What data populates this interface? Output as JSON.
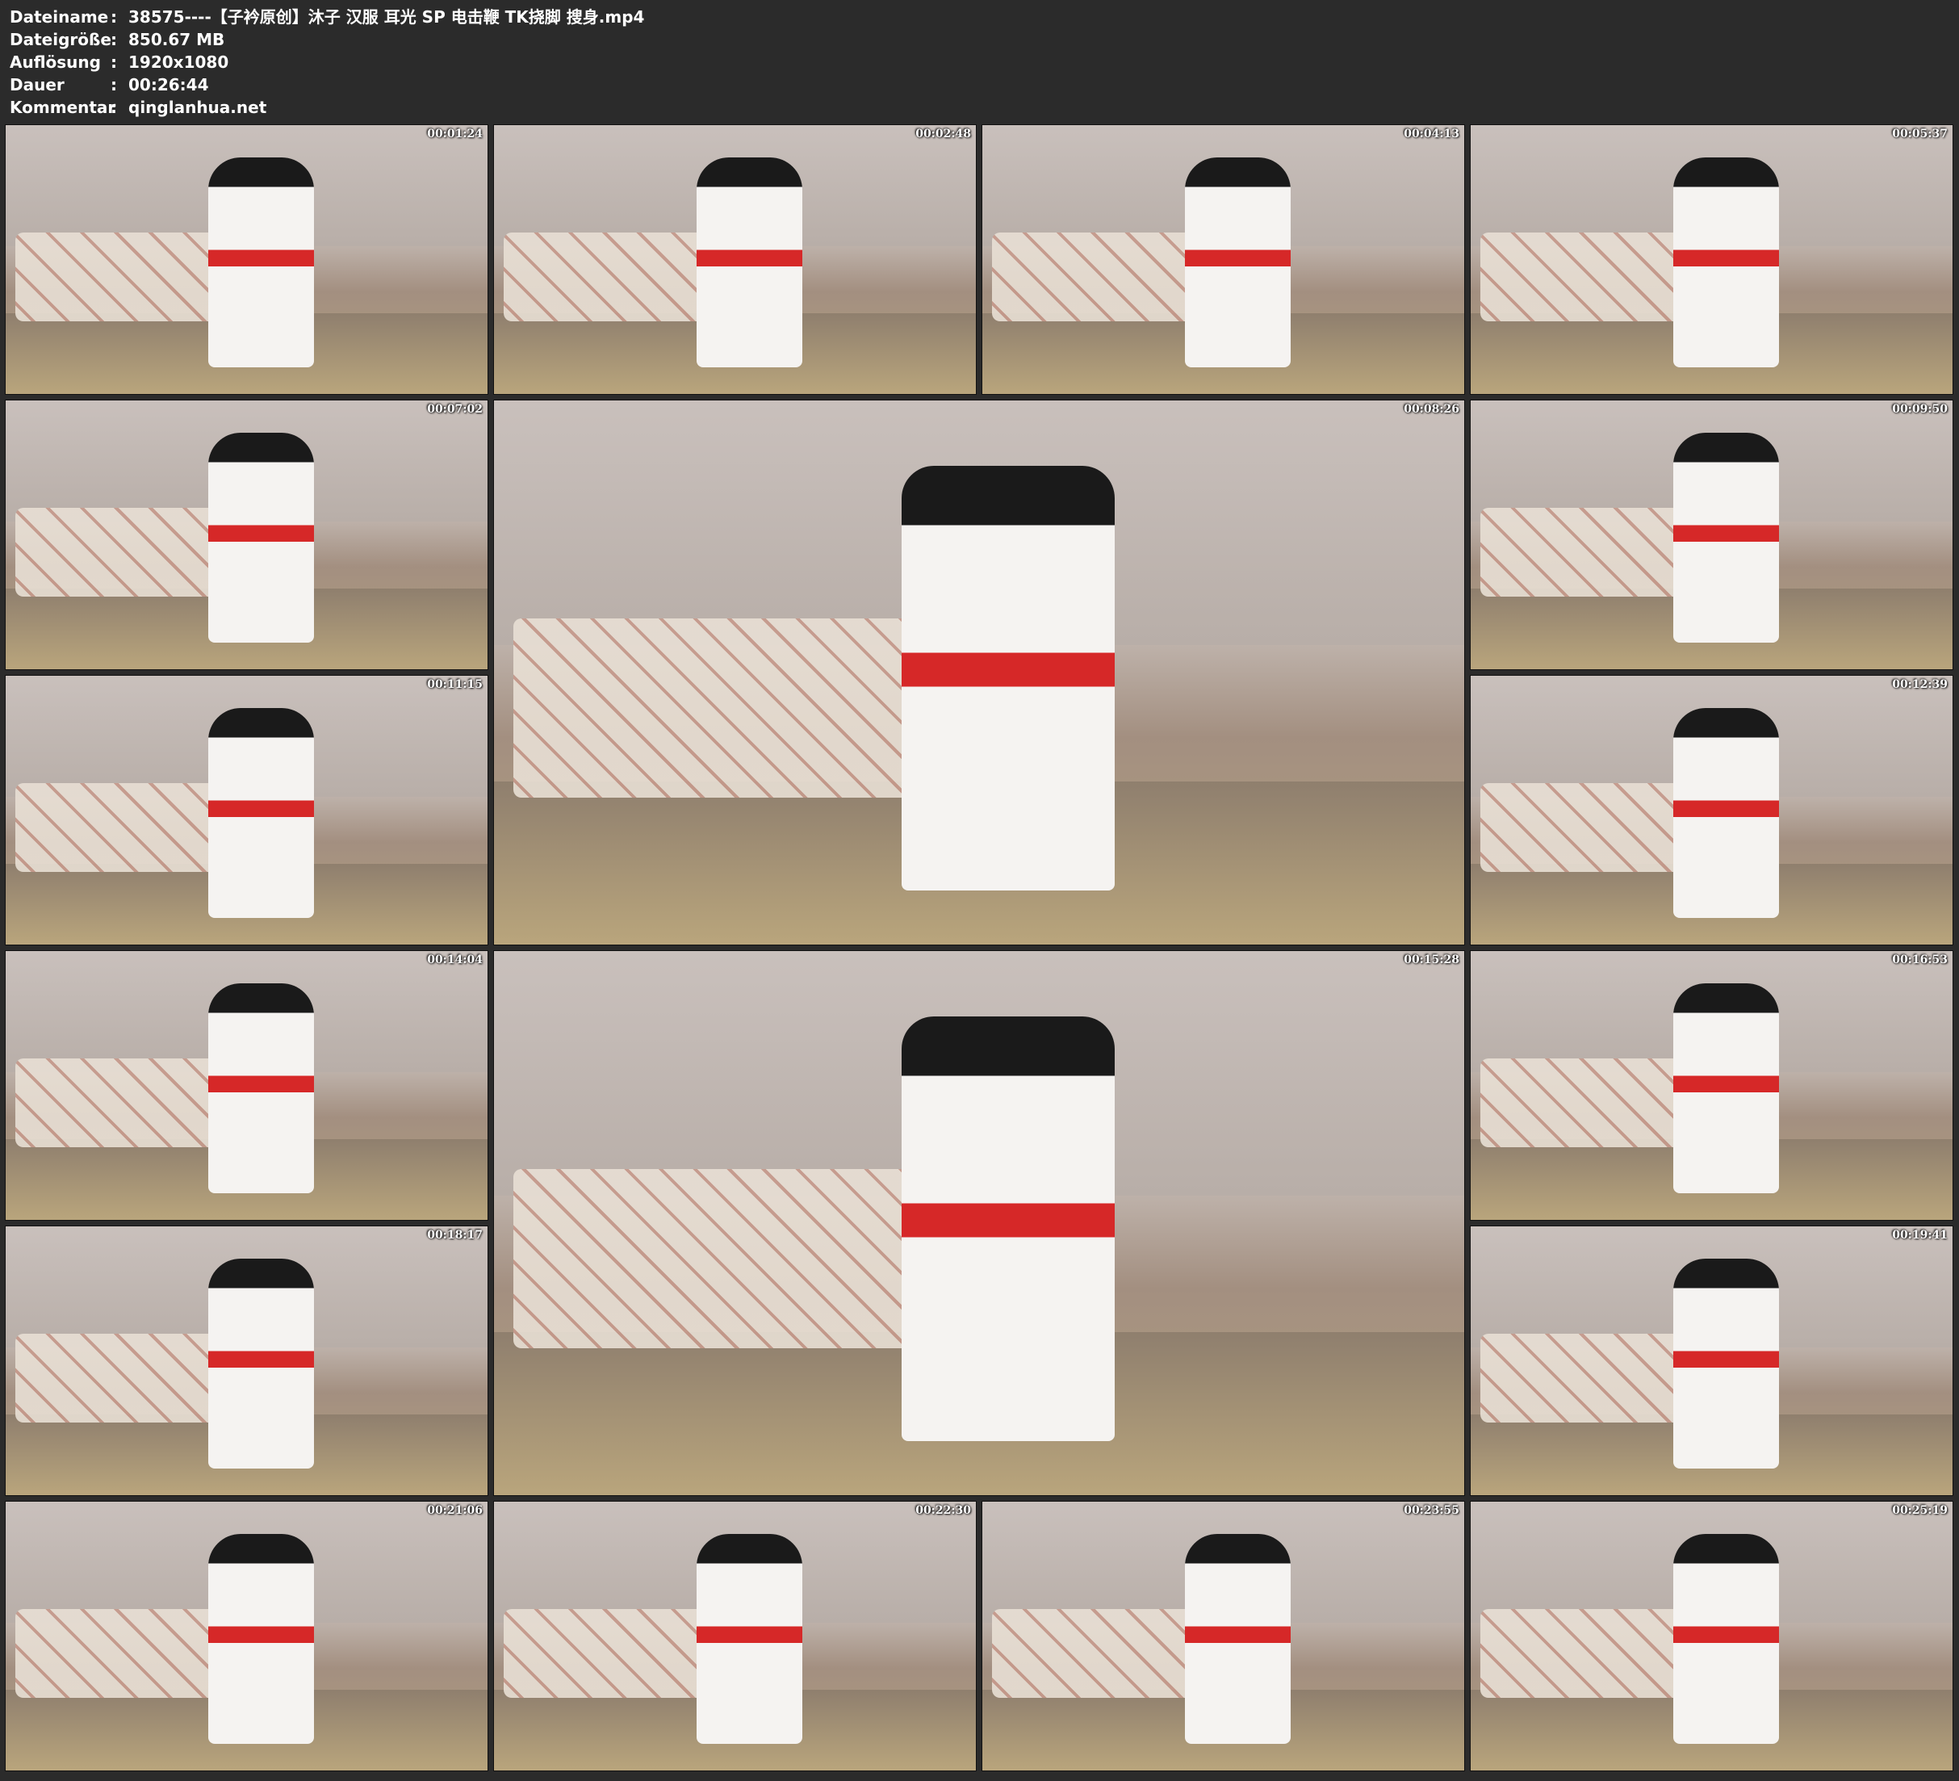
{
  "info": {
    "rows": [
      {
        "label": "Dateiname",
        "sep": ":",
        "value": "38575----【子衿原创】沐子 汉服 耳光 SP 电击鞭 TK挠脚 搜身.mp4"
      },
      {
        "label": "Dateigröße",
        "sep": ":",
        "value": "850.67 MB"
      },
      {
        "label": "Auflösung",
        "sep": ":",
        "value": "1920x1080"
      },
      {
        "label": "Dauer",
        "sep": ":",
        "value": "00:26:44"
      },
      {
        "label": "Kommentar",
        "sep": ":",
        "value": "qinglanhua.net"
      }
    ]
  },
  "thumbnails": [
    {
      "timestamp": "00:01:24"
    },
    {
      "timestamp": "00:02:48"
    },
    {
      "timestamp": "00:04:13"
    },
    {
      "timestamp": "00:05:37"
    },
    {
      "timestamp": "00:07:02"
    },
    {
      "timestamp": "00:08:26"
    },
    {
      "timestamp": "00:09:50"
    },
    {
      "timestamp": "00:11:15"
    },
    {
      "timestamp": "00:12:39"
    },
    {
      "timestamp": "00:14:04"
    },
    {
      "timestamp": "00:15:28"
    },
    {
      "timestamp": "00:16:53"
    },
    {
      "timestamp": "00:18:17"
    },
    {
      "timestamp": "00:19:41"
    },
    {
      "timestamp": "00:21:06"
    },
    {
      "timestamp": "00:22:30"
    },
    {
      "timestamp": "00:23:55"
    },
    {
      "timestamp": "00:25:19"
    }
  ]
}
